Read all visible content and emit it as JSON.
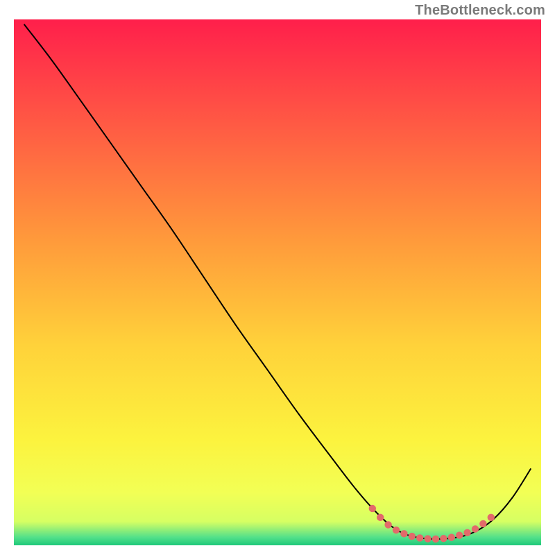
{
  "watermark": "TheBottleneck.com",
  "chart_data": {
    "type": "line",
    "title": "",
    "xlabel": "",
    "ylabel": "",
    "xlim": [
      0,
      100
    ],
    "ylim": [
      0,
      100
    ],
    "grid": false,
    "legend": false,
    "background_gradient": {
      "stops": [
        {
          "offset": 0.0,
          "color": "#ff1f4b"
        },
        {
          "offset": 0.2,
          "color": "#ff5a44"
        },
        {
          "offset": 0.42,
          "color": "#ff9a3b"
        },
        {
          "offset": 0.62,
          "color": "#ffd23a"
        },
        {
          "offset": 0.8,
          "color": "#fcf33e"
        },
        {
          "offset": 0.9,
          "color": "#f2ff55"
        },
        {
          "offset": 0.955,
          "color": "#d6ff63"
        },
        {
          "offset": 0.985,
          "color": "#52e08a"
        },
        {
          "offset": 1.0,
          "color": "#1fc87a"
        }
      ]
    },
    "series": [
      {
        "name": "bottleneck-curve",
        "color": "#000000",
        "points": [
          {
            "x": 2.0,
            "y": 99.0
          },
          {
            "x": 7.0,
            "y": 92.5
          },
          {
            "x": 12.0,
            "y": 85.5
          },
          {
            "x": 18.0,
            "y": 77.0
          },
          {
            "x": 24.0,
            "y": 68.5
          },
          {
            "x": 30.0,
            "y": 60.0
          },
          {
            "x": 36.0,
            "y": 51.0
          },
          {
            "x": 42.0,
            "y": 42.0
          },
          {
            "x": 48.0,
            "y": 33.5
          },
          {
            "x": 54.0,
            "y": 25.0
          },
          {
            "x": 60.0,
            "y": 17.0
          },
          {
            "x": 65.0,
            "y": 10.5
          },
          {
            "x": 69.0,
            "y": 6.0
          },
          {
            "x": 72.5,
            "y": 3.0
          },
          {
            "x": 76.0,
            "y": 1.6
          },
          {
            "x": 80.0,
            "y": 1.2
          },
          {
            "x": 84.0,
            "y": 1.5
          },
          {
            "x": 87.5,
            "y": 2.6
          },
          {
            "x": 91.0,
            "y": 5.0
          },
          {
            "x": 94.5,
            "y": 9.0
          },
          {
            "x": 98.0,
            "y": 14.5
          }
        ]
      },
      {
        "name": "optimal-range-markers",
        "type": "scatter",
        "color": "#e36a6a",
        "marker_radius": 5.2,
        "points": [
          {
            "x": 68.0,
            "y": 7.0
          },
          {
            "x": 69.5,
            "y": 5.3
          },
          {
            "x": 71.0,
            "y": 3.9
          },
          {
            "x": 72.5,
            "y": 2.9
          },
          {
            "x": 74.0,
            "y": 2.2
          },
          {
            "x": 75.5,
            "y": 1.7
          },
          {
            "x": 77.0,
            "y": 1.4
          },
          {
            "x": 78.5,
            "y": 1.25
          },
          {
            "x": 80.0,
            "y": 1.2
          },
          {
            "x": 81.5,
            "y": 1.3
          },
          {
            "x": 83.0,
            "y": 1.5
          },
          {
            "x": 84.5,
            "y": 1.9
          },
          {
            "x": 86.0,
            "y": 2.4
          },
          {
            "x": 87.5,
            "y": 3.1
          },
          {
            "x": 89.0,
            "y": 4.1
          },
          {
            "x": 90.5,
            "y": 5.3
          }
        ]
      }
    ]
  }
}
